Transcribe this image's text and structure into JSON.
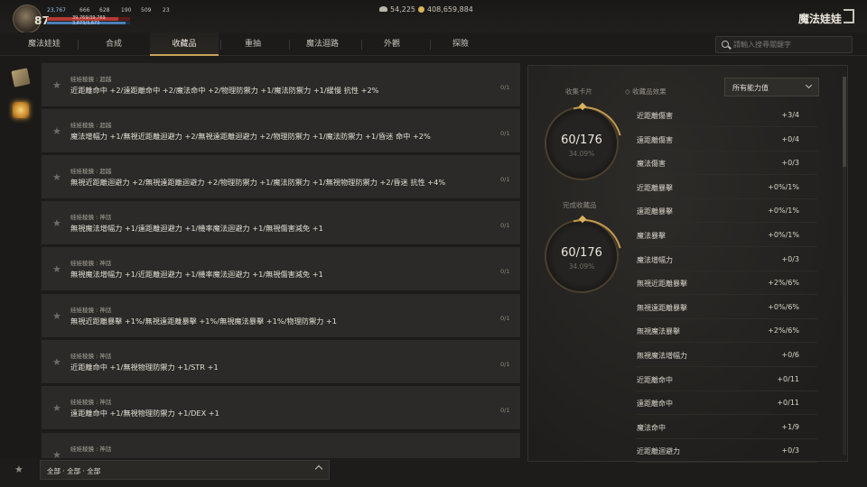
{
  "hud": {
    "level": "87",
    "stat_blue": "23,767",
    "stat1": "666",
    "stat2": "628",
    "stat3": "190",
    "stat4": "509",
    "stat5": "23",
    "hp_text": "39,769/39,769",
    "mp_text": "3,873/3,873",
    "hp_fill": 0.86,
    "mp_fill": 0.95
  },
  "currency": {
    "wing": "54,225",
    "gold": "408,659,884"
  },
  "title": "魔法娃娃",
  "tabs": [
    "魔法娃娃",
    "合成",
    "收藏品",
    "重抽",
    "魔法迴路",
    "外觀",
    "探險"
  ],
  "active_tab": "收藏品",
  "search": {
    "placeholder": "請輸入搜尋關鍵字"
  },
  "list": [
    {
      "cat": "娃娃稜鏡 : 超越",
      "eff": "近距離命中 +2/遠距離命中 +2/魔法命中 +2/物理防禦力 +1/魔法防禦力 +1/緩慢 抗性 +2%",
      "cnt": "0/1"
    },
    {
      "cat": "娃娃稜鏡 : 超越",
      "eff": "魔法增幅力 +1/無視近距離迴避力 +2/無視遠距離迴避力 +2/物理防禦力 +1/魔法防禦力 +1/昏迷 命中 +2%",
      "cnt": "0/1"
    },
    {
      "cat": "娃娃稜鏡 : 超越",
      "eff": "無視近距離迴避力 +2/無視遠距離迴避力 +2/物理防禦力 +1/魔法防禦力 +1/無視物理防禦力 +2/昏迷 抗性 +4%",
      "cnt": "0/1"
    },
    {
      "cat": "娃娃稜鏡 : 神話",
      "eff": "無視魔法增幅力 +1/遠距離迴避力 +1/機率魔法迴避力 +1/無視傷害減免 +1",
      "cnt": "0/1"
    },
    {
      "cat": "娃娃稜鏡 : 神話",
      "eff": "無視魔法增幅力 +1/近距離迴避力 +1/機率魔法迴避力 +1/無視傷害減免 +1",
      "cnt": "0/1"
    },
    {
      "cat": "娃娃稜鏡 : 神話",
      "eff": "無視近距離暴擊 +1%/無視遠距離暴擊 +1%/無視魔法暴擊 +1%/物理防禦力 +1",
      "cnt": "0/1"
    },
    {
      "cat": "娃娃稜鏡 : 神話",
      "eff": "近距離命中 +1/無視物理防禦力 +1/STR +1",
      "cnt": "0/1"
    },
    {
      "cat": "娃娃稜鏡 : 神話",
      "eff": "遠距離命中 +1/無視物理防禦力 +1/DEX +1",
      "cnt": "0/1"
    },
    {
      "cat": "娃娃稜鏡 : 神話",
      "eff": "",
      "cnt": ""
    }
  ],
  "filter": {
    "label": "全部 · 全部 · 全部"
  },
  "panel": {
    "collect_label": "收集卡片",
    "collect_num": "60/176",
    "collect_pct": "34.09%",
    "done_label": "完成收藏品",
    "done_num": "60/176",
    "done_pct": "34.09%",
    "effects_title": "◇ 收藏品效果",
    "select_label": "所有能力值"
  },
  "stats": [
    {
      "n": "近距離傷害",
      "v": "+3/4"
    },
    {
      "n": "遠距離傷害",
      "v": "+0/4"
    },
    {
      "n": "魔法傷害",
      "v": "+0/3"
    },
    {
      "n": "近距離暴擊",
      "v": "+0%/1%"
    },
    {
      "n": "遠距離暴擊",
      "v": "+0%/1%"
    },
    {
      "n": "魔法暴擊",
      "v": "+0%/1%"
    },
    {
      "n": "魔法增幅力",
      "v": "+0/3"
    },
    {
      "n": "無視近距離暴擊",
      "v": "+2%/6%"
    },
    {
      "n": "無視遠距離暴擊",
      "v": "+0%/6%"
    },
    {
      "n": "無視魔法暴擊",
      "v": "+2%/6%"
    },
    {
      "n": "無視魔法增幅力",
      "v": "+0/6"
    },
    {
      "n": "近距離命中",
      "v": "+0/11"
    },
    {
      "n": "遠距離命中",
      "v": "+0/11"
    },
    {
      "n": "魔法命中",
      "v": "+1/9"
    },
    {
      "n": "近距離迴避力",
      "v": "+0/3"
    }
  ]
}
